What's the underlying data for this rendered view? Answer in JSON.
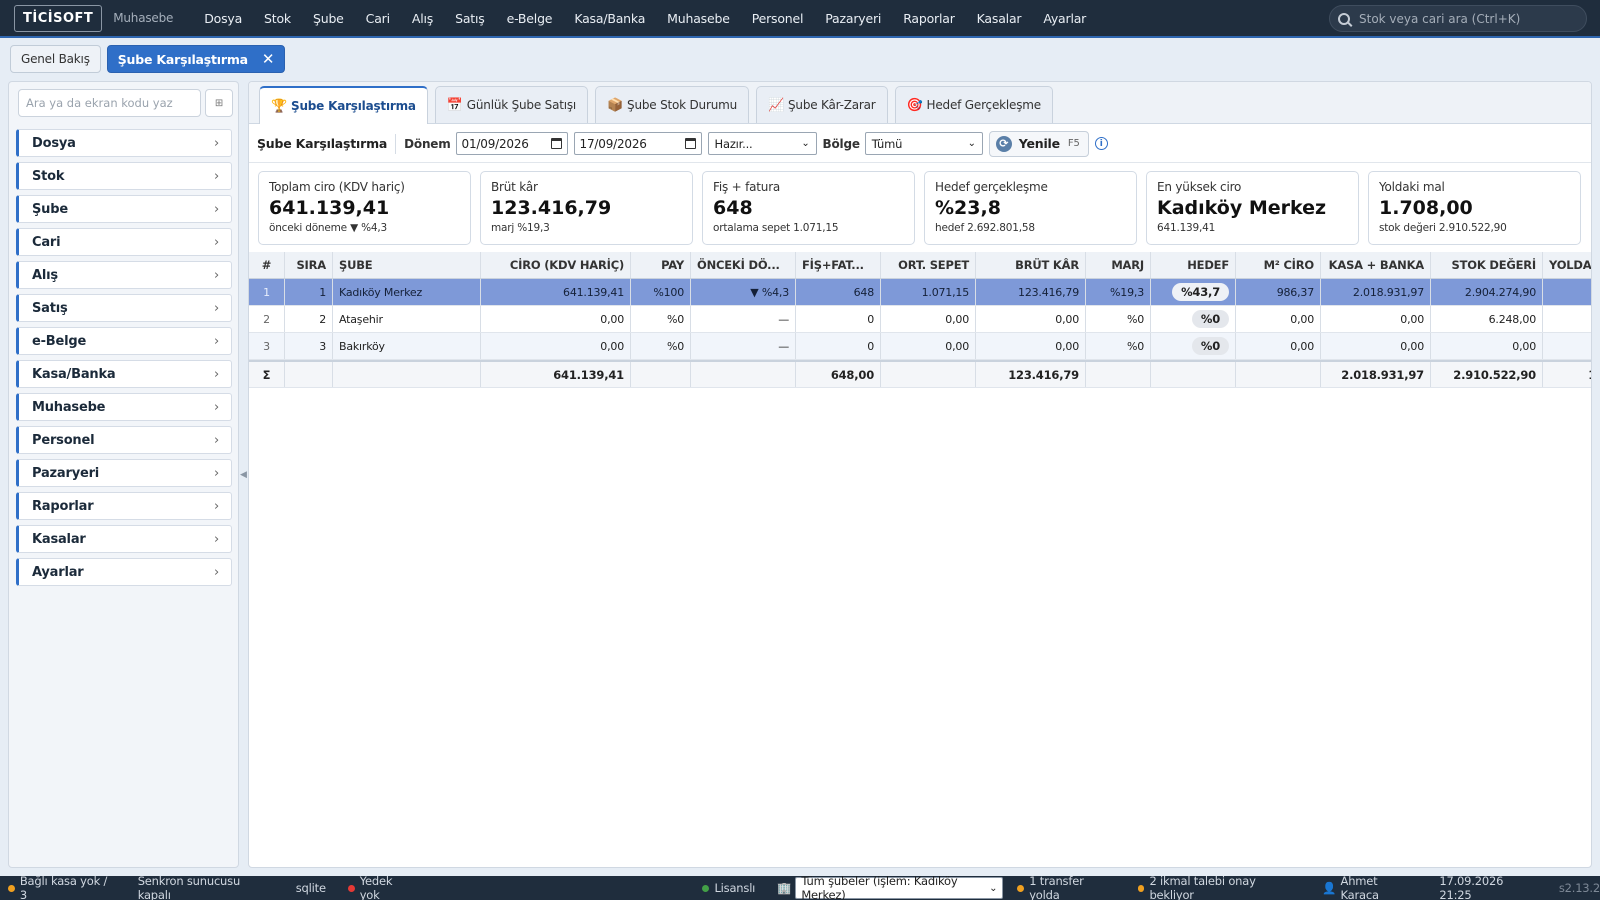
{
  "app": {
    "logo": "TİCİSOFT",
    "module": "Muhasebe"
  },
  "menu": [
    "Dosya",
    "Stok",
    "Şube",
    "Cari",
    "Alış",
    "Satış",
    "e-Belge",
    "Kasa/Banka",
    "Muhasebe",
    "Personel",
    "Pazaryeri",
    "Raporlar",
    "Kasalar",
    "Ayarlar"
  ],
  "search": {
    "placeholder": "Stok veya cari ara (Ctrl+K)"
  },
  "top_tabs": {
    "overview": "Genel Bakış",
    "active": "Şube Karşılaştırma",
    "close": "✕"
  },
  "sidebar": {
    "search_placeholder": "Ara ya da ekran kodu yaz",
    "grid_btn": "⊞",
    "items": [
      "Dosya",
      "Stok",
      "Şube",
      "Cari",
      "Alış",
      "Satış",
      "e-Belge",
      "Kasa/Banka",
      "Muhasebe",
      "Personel",
      "Pazaryeri",
      "Raporlar",
      "Kasalar",
      "Ayarlar"
    ],
    "chevron": "›",
    "collapse": "◀"
  },
  "subtabs": [
    {
      "icon": "🏆",
      "label": "Şube Karşılaştırma"
    },
    {
      "icon": "📅",
      "label": "Günlük Şube Satışı"
    },
    {
      "icon": "📦",
      "label": "Şube Stok Durumu"
    },
    {
      "icon": "📈",
      "label": "Şube Kâr-Zarar"
    },
    {
      "icon": "🎯",
      "label": "Hedef Gerçekleşme"
    }
  ],
  "toolbar": {
    "title": "Şube Karşılaştırma",
    "period_label": "Dönem",
    "date_from": "01/09/2026",
    "date_to": "17/09/2026",
    "preset": "Hazır...",
    "region_label": "Bölge",
    "region": "Tümü",
    "refresh": "Yenile",
    "refresh_key": "F5",
    "info": "i",
    "refresh_icon": "⟳",
    "dropdown_arrow": "⌄"
  },
  "kpis": [
    {
      "title": "Toplam ciro (KDV hariç)",
      "value": "641.139,41",
      "sub": "önceki döneme ▼ %4,3"
    },
    {
      "title": "Brüt kâr",
      "value": "123.416,79",
      "sub": "marj %19,3"
    },
    {
      "title": "Fiş + fatura",
      "value": "648",
      "sub": "ortalama sepet 1.071,15"
    },
    {
      "title": "Hedef gerçekleşme",
      "value": "%23,8",
      "sub": "hedef 2.692.801,58"
    },
    {
      "title": "En yüksek ciro",
      "value": "Kadıköy Merkez",
      "sub": "641.139,41"
    },
    {
      "title": "Yoldaki mal",
      "value": "1.708,00",
      "sub": "stok değeri 2.910.522,90"
    }
  ],
  "table": {
    "headers": [
      "#",
      "SIRA",
      "ŞUBE",
      "CİRO (KDV HARİÇ)",
      "PAY",
      "ÖNCEKİ DÖ...",
      "FİŞ+FAT...",
      "ORT. SEPET",
      "BRÜT KÂR",
      "MARJ",
      "HEDEF",
      "M² CİRO",
      "KASA + BANKA",
      "STOK DEĞERİ",
      "YOLDA"
    ],
    "rows": [
      [
        "1",
        "1",
        "Kadıköy Merkez",
        "641.139,41",
        "%100",
        "▼ %4,3",
        "648",
        "1.071,15",
        "123.416,79",
        "%19,3",
        "%43,7",
        "986,37",
        "2.018.931,97",
        "2.904.274,90",
        ""
      ],
      [
        "2",
        "2",
        "Ataşehir",
        "0,00",
        "%0",
        "—",
        "0",
        "0,00",
        "0,00",
        "%0",
        "%0",
        "0,00",
        "0,00",
        "6.248,00",
        ""
      ],
      [
        "3",
        "3",
        "Bakırköy",
        "0,00",
        "%0",
        "—",
        "0",
        "0,00",
        "0,00",
        "%0",
        "%0",
        "0,00",
        "0,00",
        "0,00",
        ""
      ]
    ],
    "sum": [
      "Σ",
      "",
      "",
      "641.139,41",
      "",
      "",
      "648,00",
      "",
      "123.416,79",
      "",
      "",
      "",
      "2.018.931,97",
      "2.910.522,90",
      "1"
    ]
  },
  "status": {
    "kasa": "Bağlı kasa yok / 3",
    "sync": "Senkron sunucusu kapalı",
    "db": "sqlite",
    "backup": "Yedek yok",
    "license": "Lisanslı",
    "branch_icon": "🏢",
    "branch": "Tüm şubeler (işlem: Kadıköy Merkez)",
    "transfer": "1 transfer yolda",
    "approval": "2 ikmal talebi onay bekliyor",
    "user_icon": "👤",
    "user": "Ahmet Karaca",
    "datetime": "17.09.2026 21:25",
    "version": "s2.13.2"
  },
  "colors": {
    "accent": "#2f6fc8",
    "topbar": "#1f2d3d",
    "selected_row": "#7e99d8",
    "negative": "#dd1111"
  }
}
